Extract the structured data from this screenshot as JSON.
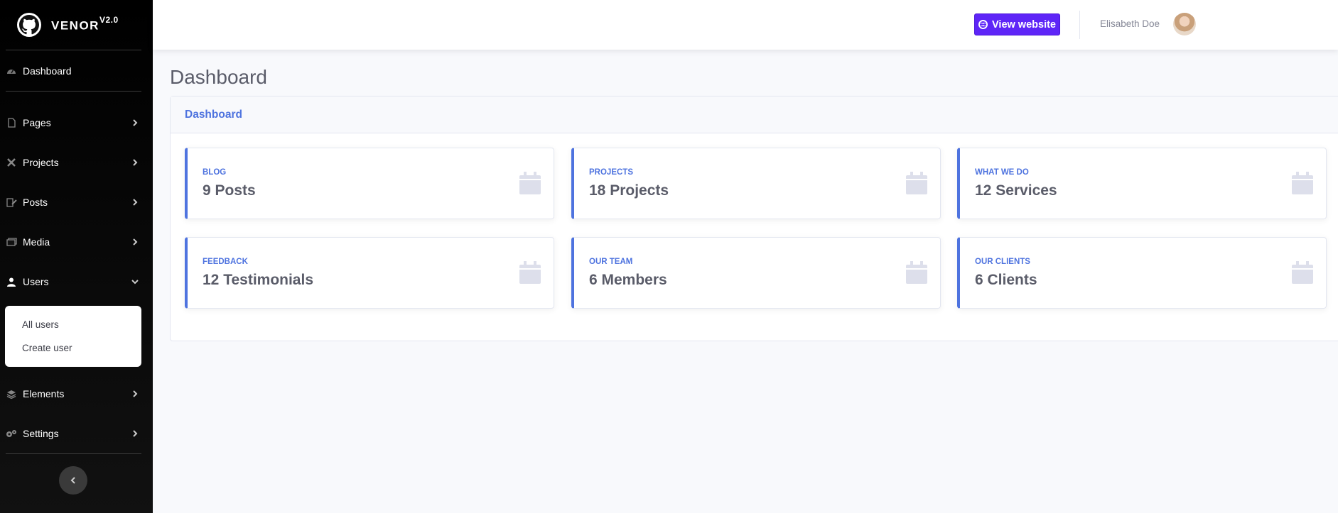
{
  "brand": {
    "name": "VENOR",
    "version": "V2.0"
  },
  "sidebar": {
    "items": [
      {
        "label": "Dashboard",
        "icon": "dashboard-icon"
      },
      {
        "label": "Pages",
        "icon": "file-icon"
      },
      {
        "label": "Projects",
        "icon": "tools-icon"
      },
      {
        "label": "Posts",
        "icon": "pen-icon"
      },
      {
        "label": "Media",
        "icon": "media-icon"
      },
      {
        "label": "Users",
        "icon": "user-icon"
      },
      {
        "label": "Elements",
        "icon": "layers-icon"
      },
      {
        "label": "Settings",
        "icon": "gears-icon"
      }
    ],
    "users_submenu": [
      {
        "label": "All users"
      },
      {
        "label": "Create user"
      }
    ]
  },
  "topbar": {
    "view_website_label": "View website",
    "user_name": "Elisabeth Doe"
  },
  "main": {
    "page_title": "Dashboard",
    "panel_title": "Dashboard",
    "cards": [
      {
        "label": "BLOG",
        "value": "9 Posts"
      },
      {
        "label": "PROJECTS",
        "value": "18 Projects"
      },
      {
        "label": "WHAT WE DO",
        "value": "12 Services"
      },
      {
        "label": "FEEDBACK",
        "value": "12 Testimonials"
      },
      {
        "label": "OUR TEAM",
        "value": "6 Members"
      },
      {
        "label": "OUR CLIENTS",
        "value": "6 Clients"
      }
    ]
  },
  "colors": {
    "accent": "#4e73df",
    "button": "#5e25f7",
    "sidebar_bg": "#000000"
  }
}
